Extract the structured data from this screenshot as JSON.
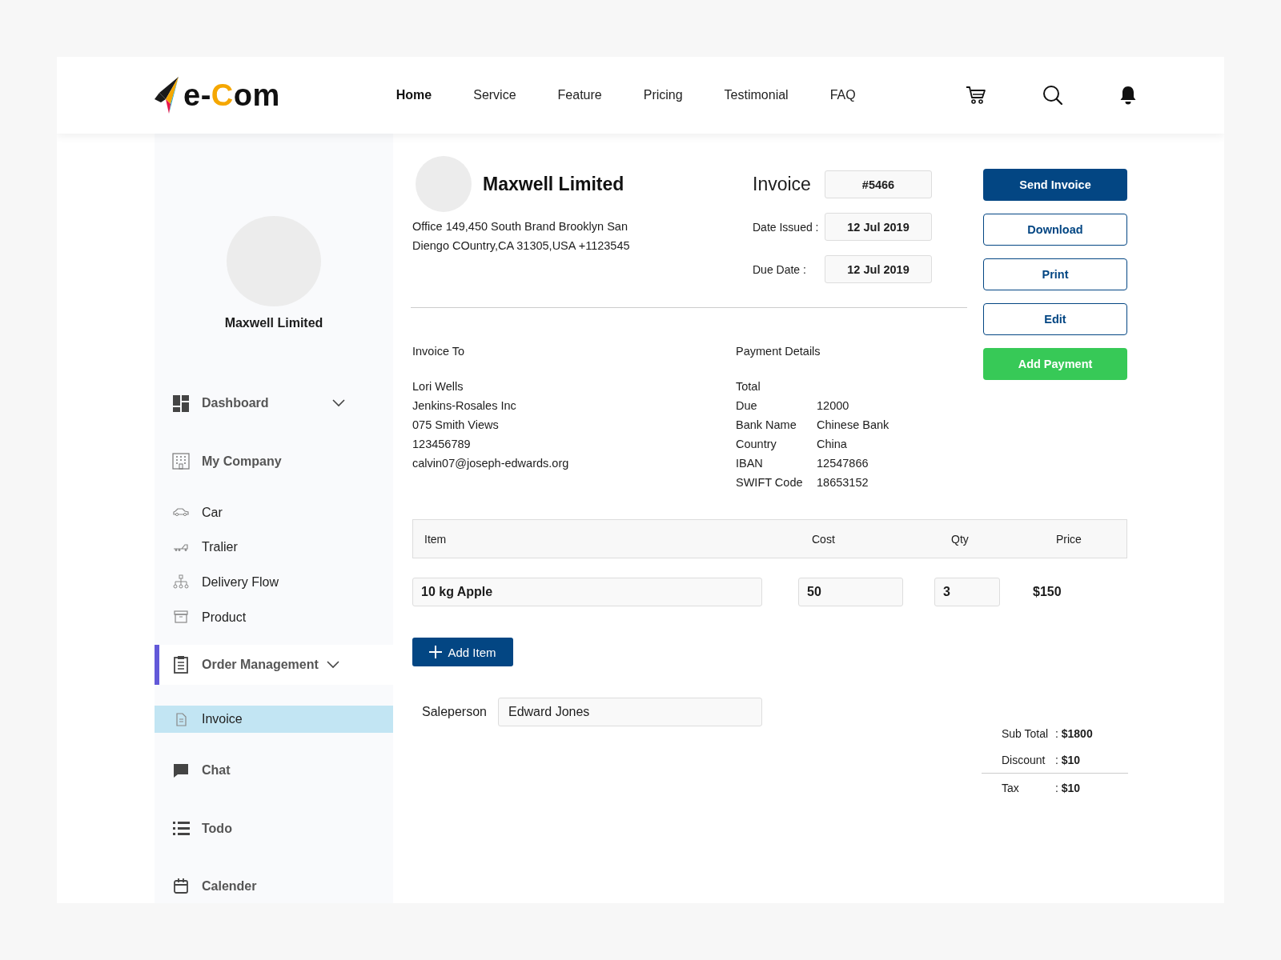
{
  "header": {
    "logo": [
      {
        "text": "e-",
        "accent": false
      },
      {
        "text": "C",
        "accent": true
      },
      {
        "text": "om",
        "accent": false
      }
    ],
    "nav": [
      {
        "label": "Home",
        "selected": true
      },
      {
        "label": "Service",
        "selected": false
      },
      {
        "label": "Feature",
        "selected": false
      },
      {
        "label": "Pricing",
        "selected": false
      },
      {
        "label": "Testimonial",
        "selected": false
      },
      {
        "label": "FAQ",
        "selected": false
      }
    ]
  },
  "sidebar": {
    "company": "Maxwell Limited",
    "items": [
      {
        "label": "Dashboard",
        "kind": "section",
        "dropdown": true,
        "active": false,
        "selected": false
      },
      {
        "label": "My Company",
        "kind": "section",
        "dropdown": false,
        "active": false,
        "selected": false
      },
      {
        "label": "Car",
        "kind": "sub",
        "dropdown": false,
        "active": false,
        "selected": false
      },
      {
        "label": "Tralier",
        "kind": "sub",
        "dropdown": false,
        "active": false,
        "selected": false
      },
      {
        "label": "Delivery Flow",
        "kind": "sub",
        "dropdown": false,
        "active": false,
        "selected": false
      },
      {
        "label": "Product",
        "kind": "sub",
        "dropdown": false,
        "active": false,
        "selected": false
      },
      {
        "label": "Order Management",
        "kind": "section",
        "dropdown": true,
        "active": true,
        "selected": false
      },
      {
        "label": "Invoice",
        "kind": "sub",
        "dropdown": false,
        "active": false,
        "selected": true
      },
      {
        "label": "Chat",
        "kind": "section",
        "dropdown": false,
        "active": false,
        "selected": false
      },
      {
        "label": "Todo",
        "kind": "section",
        "dropdown": false,
        "active": false,
        "selected": false
      },
      {
        "label": "Calender",
        "kind": "section",
        "dropdown": false,
        "active": false,
        "selected": false
      }
    ]
  },
  "invoice": {
    "company": "Maxwell Limited",
    "address": "Office 149,450 South Brand Brooklyn San Diengo COuntry,CA 31305,USA +1123545",
    "title": "Invoice",
    "number": "#5466",
    "dates": [
      {
        "label": "Date Issued :",
        "value": "12 Jul 2019"
      },
      {
        "label": "Due Date :",
        "value": "12 Jul 2019"
      }
    ],
    "invoice_to": {
      "heading": "Invoice To",
      "lines": [
        "Lori Wells",
        "Jenkins-Rosales Inc",
        "075 Smith Views",
        "123456789",
        "calvin07@joseph-edwards.org"
      ]
    },
    "payment": {
      "heading": "Payment Details",
      "rows": [
        {
          "label": "Total"
        },
        {
          "label": "Due",
          "value": "12000"
        },
        {
          "label": "Bank Name",
          "value": "Chinese Bank"
        },
        {
          "label": "Country",
          "value": "China"
        },
        {
          "label": "IBAN",
          "value": "12547866"
        },
        {
          "label": "SWIFT Code",
          "value": "18653152"
        }
      ]
    },
    "actions": [
      {
        "label": "Send Invoice",
        "kind": "primary"
      },
      {
        "label": "Download",
        "kind": "outline"
      },
      {
        "label": "Print",
        "kind": "outline"
      },
      {
        "label": "Edit",
        "kind": "outline"
      },
      {
        "label": "Add Payment",
        "kind": "success"
      }
    ],
    "table": {
      "columns": [
        "Item",
        "Cost",
        "Qty",
        "Price"
      ],
      "rows": [
        {
          "item": "10 kg Apple",
          "cost": "50",
          "qty": "3",
          "price": "$150"
        }
      ]
    },
    "add_item": "Add Item",
    "salesperson": {
      "label": "Saleperson",
      "value": "Edward Jones"
    },
    "totals": [
      {
        "label": "Sub Total",
        "value": ": **$1800**"
      },
      {
        "label": "Discount",
        "value": ": **$10**"
      },
      {
        "label": "Tax",
        "value": ": **$10**"
      }
    ]
  }
}
